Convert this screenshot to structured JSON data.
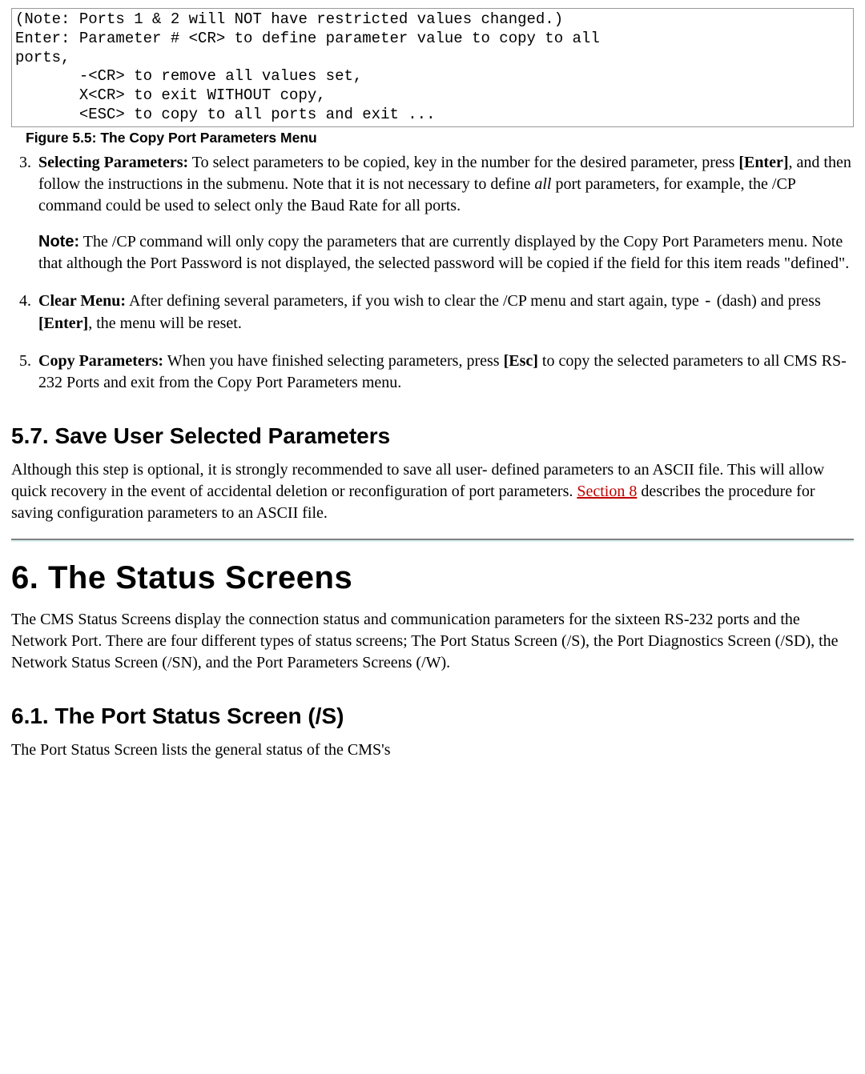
{
  "codebox": {
    "line1": "(Note: Ports 1 & 2 will NOT have restricted values changed.)",
    "line2": "Enter: Parameter # <CR> to define parameter value to copy to all",
    "line3": "ports,",
    "line4": "       -<CR> to remove all values set,",
    "line5": "       X<CR> to exit WITHOUT copy,",
    "line6": "       <ESC> to copy to all ports and exit ..."
  },
  "fig_caption": "Figure 5.5:   The Copy Port Parameters Menu",
  "item3": {
    "lead": "Selecting Parameters:",
    "t1": " To select parameters to be copied, key in the number for the desired parameter, press ",
    "enter": "[Enter]",
    "t2": ", and then follow the instructions in the submenu. Note that it is not necessary to define ",
    "all": "all",
    "t3": " port parameters, for example, the /CP command could be used to select only the Baud Rate for all ports."
  },
  "note": {
    "label": "Note:",
    "text": "  The /CP command will only copy the parameters that are currently displayed by the Copy Port Parameters menu. Note that although the Port Password is not displayed, the selected password will be copied if the field for this item reads \"defined\"."
  },
  "item4": {
    "lead": "Clear Menu:",
    "t1": " After defining several parameters, if you wish to clear the /CP menu and start again, type ",
    "dash": "-",
    "t2": " (dash) and press ",
    "enter": "[Enter]",
    "t3": ", the menu will be reset."
  },
  "item5": {
    "lead": "Copy Parameters:",
    "t1": " When you have finished selecting parameters, press ",
    "esc": "[Esc]",
    "t2": " to copy the selected parameters to all CMS RS-232 Ports and exit from the Copy Port Parameters menu."
  },
  "sec57_title": "5.7.   Save User Selected Parameters",
  "sec57_p1a": "Although this step is optional, it is strongly recommended to save all user- defined parameters to an ASCII file. This will allow quick recovery in the event of accidental deletion or reconfiguration of port parameters. ",
  "sec57_link": "Section 8",
  "sec57_p1b": " describes the procedure for saving configuration parameters to an ASCII file.",
  "chap6_title": "6.   The Status Screens",
  "chap6_p": "The CMS Status Screens display the connection status and communication parameters for the sixteen RS-232 ports and the Network Port. There are four different types of status screens; The Port Status Screen (/S), the Port Diagnostics Screen (/SD), the Network Status Screen (/SN), and the Port Parameters Screens (/W).",
  "sec61_title": "6.1.   The Port Status Screen (/S)",
  "sec61_p": "The Port Status Screen lists the general status of the CMS's"
}
